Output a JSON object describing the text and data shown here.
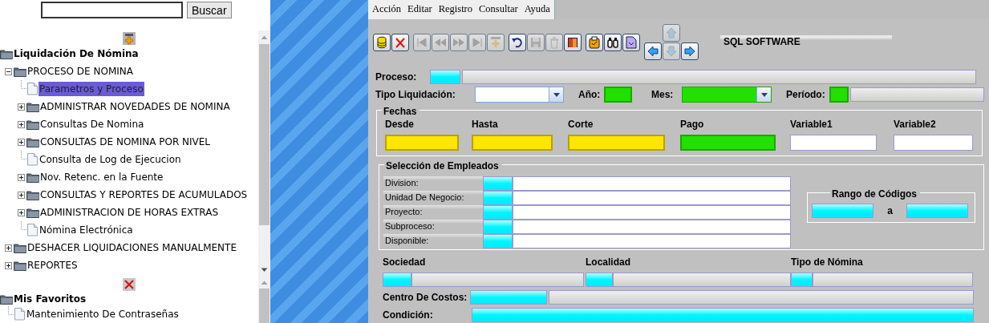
{
  "search": {
    "button": "Buscar"
  },
  "tree": {
    "title": "Liquidación De Nómina",
    "children": [
      {
        "label": "PROCESO DE NOMINA",
        "kind": "folder",
        "expanded": true,
        "selected": false,
        "children": [
          {
            "label": "Parametros y Proceso",
            "kind": "page",
            "selected": true
          },
          {
            "label": "ADMINISTRAR NOVEDADES DE NOMINA",
            "kind": "folder",
            "expanded": false,
            "selected": false
          },
          {
            "label": "Consultas De Nomina",
            "kind": "folder",
            "expanded": false,
            "selected": false
          },
          {
            "label": "CONSULTAS DE NOMINA POR NIVEL",
            "kind": "folder",
            "expanded": false,
            "selected": false
          },
          {
            "label": "Consulta de Log de Ejecucion",
            "kind": "page",
            "selected": false
          },
          {
            "label": "Nov. Retenc. en la Fuente",
            "kind": "folder",
            "expanded": false,
            "selected": false
          },
          {
            "label": "CONSULTAS Y REPORTES DE ACUMULADOS",
            "kind": "folder",
            "expanded": false,
            "selected": false
          },
          {
            "label": "ADMINISTRACION DE HORAS EXTRAS",
            "kind": "folder",
            "expanded": false,
            "selected": false
          },
          {
            "label": "Nómina Electrónica",
            "kind": "page",
            "selected": false
          }
        ]
      },
      {
        "label": "DESHACER LIQUIDACIONES MANUALMENTE",
        "kind": "folder",
        "expanded": false,
        "selected": false
      },
      {
        "label": "REPORTES",
        "kind": "folder",
        "expanded": false,
        "selected": false
      }
    ]
  },
  "favorites": {
    "title": "Mis Favoritos",
    "children": [
      {
        "label": "Mantenimiento De Contraseñas",
        "kind": "page",
        "selected": false
      }
    ]
  },
  "menu": [
    "Acción",
    "Editar",
    "Registro",
    "Consultar",
    "Ayuda"
  ],
  "toolbar": [
    [
      {
        "kind": "database",
        "disabled": false
      },
      {
        "kind": "cancel",
        "disabled": false
      }
    ],
    [
      {
        "kind": "first",
        "disabled": true
      },
      {
        "kind": "prev",
        "disabled": true
      },
      {
        "kind": "next",
        "disabled": true
      },
      {
        "kind": "last",
        "disabled": true
      },
      {
        "kind": "add",
        "disabled": true
      }
    ],
    [
      {
        "kind": "undo",
        "disabled": false
      },
      {
        "kind": "save",
        "disabled": true
      },
      {
        "kind": "trash",
        "disabled": true
      },
      {
        "kind": "exit",
        "disabled": false
      }
    ],
    [
      {
        "kind": "clipboard",
        "disabled": false
      },
      {
        "kind": "binoculars",
        "disabled": false
      },
      {
        "kind": "document",
        "disabled": false
      }
    ]
  ],
  "nav_pad": [
    {
      "kind": "up",
      "disabled": true
    },
    {
      "kind": "left",
      "disabled": false
    },
    {
      "kind": "down",
      "disabled": true
    },
    {
      "kind": "right",
      "disabled": false
    }
  ],
  "brand": "SQL SOFTWARE",
  "form": {
    "proceso": "Proceso:",
    "tipo": "Tipo Liquidación:",
    "anio": "Año:",
    "mes": "Mes:",
    "periodo": "Período:"
  },
  "fechas": {
    "title": "Fechas",
    "fields": [
      {
        "label": "Desde",
        "color": "#ffe600"
      },
      {
        "label": "Hasta",
        "color": "#ffe600"
      },
      {
        "label": "Corte",
        "color": "#ffe600"
      },
      {
        "label": "Pago",
        "color": "#22e000"
      },
      {
        "label": "Variable1",
        "color": "#ffffff"
      },
      {
        "label": "Variable2",
        "color": "#ffffff"
      }
    ]
  },
  "seleccion": {
    "title": "Selección de Empleados",
    "rows": [
      "Division:",
      "Unidad De Negocio:",
      "Proyecto:",
      "Subproceso:",
      "Disponible:"
    ],
    "rango": {
      "title": "Rango de Códigos",
      "separator": "a"
    }
  },
  "lookups": [
    "Sociedad",
    "Localidad",
    "Tipo de Nómina"
  ],
  "centro_costos": "Centro De Costos:",
  "condicion": "Condición:"
}
